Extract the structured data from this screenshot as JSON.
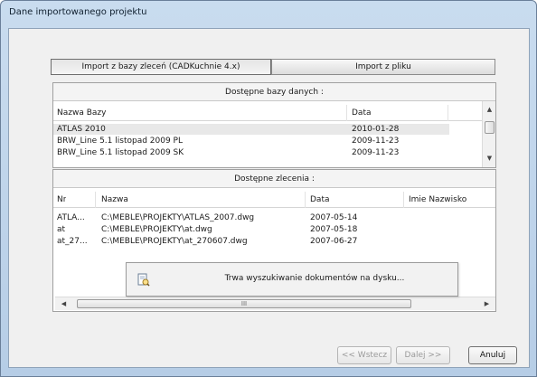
{
  "window": {
    "title": "Dane importowanego projektu"
  },
  "tabs": [
    {
      "label": "Import z bazy zleceń (CADKuchnie 4.x)",
      "active": true
    },
    {
      "label": "Import z pliku",
      "active": false
    }
  ],
  "databases": {
    "caption": "Dostępne bazy danych :",
    "columns": [
      "Nazwa Bazy",
      "Data"
    ],
    "rows": [
      {
        "name": "ATLAS 2010",
        "date": "2010-01-28",
        "selected": true
      },
      {
        "name": "BRW_Line 5.1 listopad 2009 PL",
        "date": "2009-11-23",
        "selected": false
      },
      {
        "name": "BRW_Line 5.1 listopad 2009 SK",
        "date": "2009-11-23",
        "selected": false
      }
    ]
  },
  "orders": {
    "caption": "Dostępne zlecenia :",
    "columns": [
      "Nr",
      "Nazwa",
      "Data",
      "Imie Nazwisko"
    ],
    "rows": [
      {
        "nr": "ATLA...",
        "name": "C:\\MEBLE\\PROJEKTY\\ATLAS_2007.dwg",
        "date": "2007-05-14",
        "person": ""
      },
      {
        "nr": "at",
        "name": "C:\\MEBLE\\PROJEKTY\\at.dwg",
        "date": "2007-05-18",
        "person": ""
      },
      {
        "nr": "at_27...",
        "name": "C:\\MEBLE\\PROJEKTY\\at_270607.dwg",
        "date": "2007-06-27",
        "person": ""
      }
    ]
  },
  "progress_popup": {
    "message": "Trwa wyszukiwanie dokumentów na dysku..."
  },
  "scrollbar": {
    "thumb_glyph": "III"
  },
  "buttons": {
    "back": "<< Wstecz",
    "next": "Dalej >>",
    "cancel": "Anuluj"
  },
  "colors": {
    "title_bar": "#c9dcef",
    "client_bg": "#f0f0f0",
    "selected_row": "#e8e8e8"
  }
}
